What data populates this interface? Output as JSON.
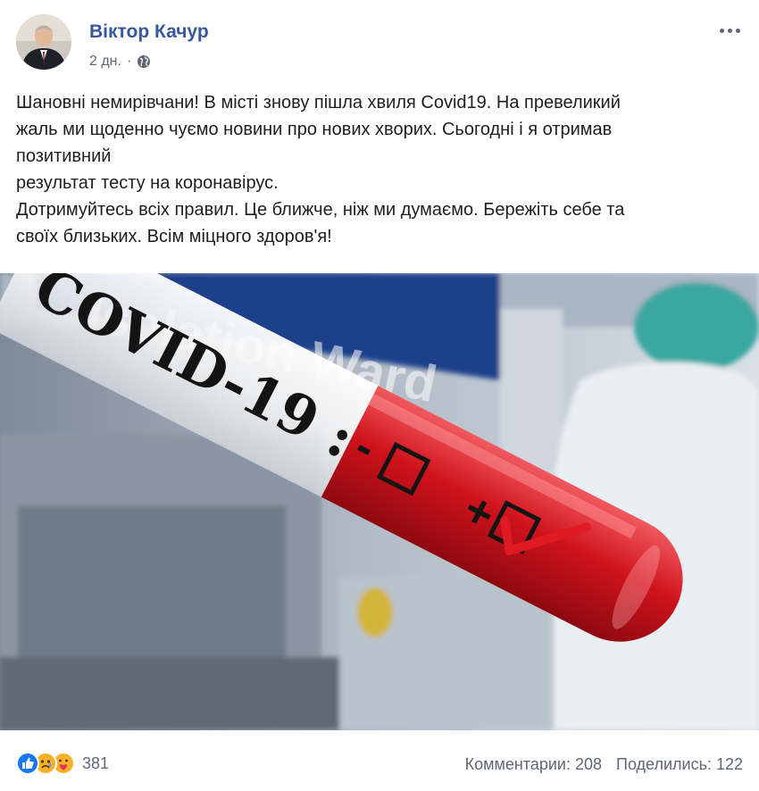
{
  "post": {
    "author": "Віктор Качур",
    "time": "2 дн.",
    "separator": "·",
    "privacy_icon": "globe-icon",
    "text": "Шановні немирівчани! В місті знову пішла хвиля Covid19. На превеликий\nжаль ми щоденно чуємо новини про нових хворих. Сьогодні і я отримав\nпозитивний\nрезультат тесту на коронавірус.\nДотримуйтесь всіх правил. Це ближче, ніж ми думаємо. Бережіть себе та\nсвоїх близьких. Всім міцного здоров'я!"
  },
  "image": {
    "ward_sign": "Isolation Ward",
    "tube_label": "COVID-19 :",
    "negative_mark": "-",
    "positive_mark": "+"
  },
  "footer": {
    "reactions": [
      "like-icon",
      "sad-icon",
      "care-icon"
    ],
    "reaction_count": "381",
    "comments": "Комментарии: 208",
    "shares": "Поделились: 122"
  },
  "colors": {
    "link": "#385898",
    "meta": "#606770",
    "tube_red": "#d0121b"
  }
}
